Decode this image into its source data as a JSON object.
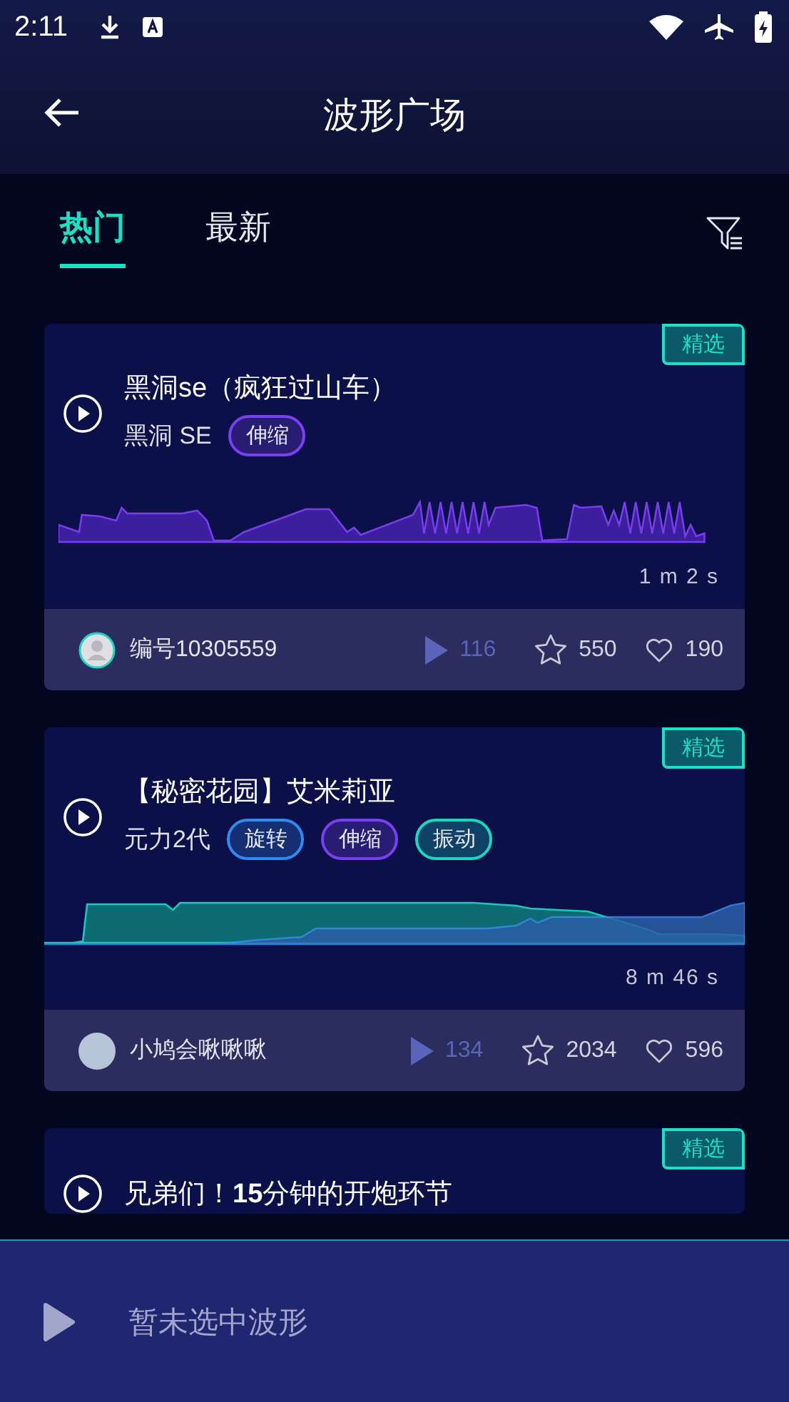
{
  "status_bar": {
    "time": "2:11"
  },
  "header": {
    "title": "波形广场"
  },
  "tabs": [
    {
      "label": "热门",
      "selected": true
    },
    {
      "label": "最新",
      "selected": false
    }
  ],
  "cards": [
    {
      "featured": true,
      "badge": "精选",
      "title": "黑洞se（疯狂过山车）",
      "subtitle": "黑洞 SE",
      "tags": [
        {
          "label": "伸缩",
          "color": "#7b3ff2"
        }
      ],
      "duration": "1 m 2 s",
      "author": {
        "name": "编号10305559",
        "kind": "default"
      },
      "plays": "116",
      "stars": "550",
      "likes": "190"
    },
    {
      "featured": true,
      "badge": "精选",
      "title": "【秘密花园】艾米莉亚",
      "subtitle": "元力2代",
      "tags": [
        {
          "label": "旋转",
          "color": "#2f8bf0"
        },
        {
          "label": "伸缩",
          "color": "#7b3ff2"
        },
        {
          "label": "振动",
          "color": "#18d8c0"
        }
      ],
      "duration": "8 m 46 s",
      "author": {
        "name": "小鸠会啾啾啾",
        "kind": "photo"
      },
      "plays": "134",
      "stars": "2034",
      "likes": "596"
    },
    {
      "featured": true,
      "badge": "精选",
      "title": "兄弟们！**15**分钟的开炮环节"
    }
  ],
  "player": {
    "text": "暂未选中波形"
  }
}
